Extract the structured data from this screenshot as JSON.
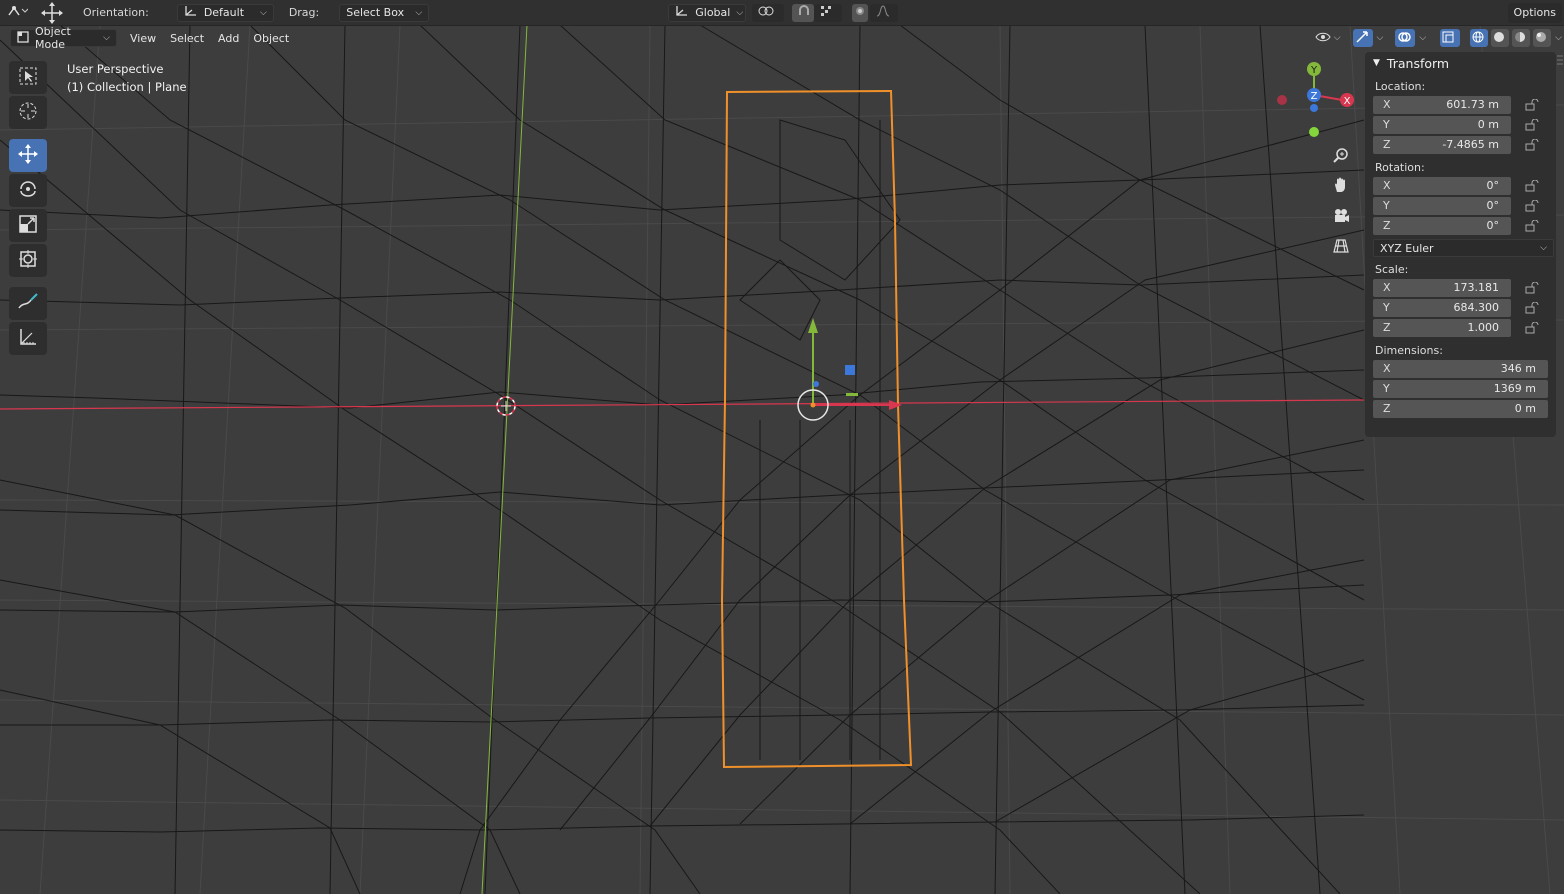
{
  "header": {
    "orientation_label": "Orientation:",
    "orientation_value": "Default",
    "drag_label": "Drag:",
    "drag_value": "Select Box",
    "transform_space": "Global",
    "options_label": "Options"
  },
  "menubar": {
    "mode": "Object Mode",
    "items": [
      "View",
      "Select",
      "Add",
      "Object"
    ]
  },
  "overlay": {
    "line1": "User Perspective",
    "line2": "(1) Collection | Plane"
  },
  "tools": [
    "select-box",
    "cursor",
    "move",
    "rotate",
    "scale",
    "transform",
    "annotate",
    "measure"
  ],
  "gizmo": {
    "x": "X",
    "y": "Y",
    "z": "Z"
  },
  "npanel": {
    "title": "Transform",
    "location": {
      "label": "Location:",
      "rows": [
        {
          "axis": "X",
          "value": "601.73 m"
        },
        {
          "axis": "Y",
          "value": "0 m"
        },
        {
          "axis": "Z",
          "value": "-7.4865 m"
        }
      ]
    },
    "rotation": {
      "label": "Rotation:",
      "rows": [
        {
          "axis": "X",
          "value": "0°"
        },
        {
          "axis": "Y",
          "value": "0°"
        },
        {
          "axis": "Z",
          "value": "0°"
        }
      ],
      "mode": "XYZ Euler"
    },
    "scale": {
      "label": "Scale:",
      "rows": [
        {
          "axis": "X",
          "value": "173.181"
        },
        {
          "axis": "Y",
          "value": "684.300"
        },
        {
          "axis": "Z",
          "value": "1.000"
        }
      ]
    },
    "dimensions": {
      "label": "Dimensions:",
      "rows": [
        {
          "axis": "X",
          "value": "346 m"
        },
        {
          "axis": "Y",
          "value": "1369 m"
        },
        {
          "axis": "Z",
          "value": "0 m"
        }
      ]
    }
  },
  "colors": {
    "viewport_bg": "#3d3d3d",
    "selection_outline": "#f0902a",
    "x_axis": "#d9374f",
    "y_axis": "#84b83b",
    "z_axis": "#3b78d9",
    "active_tool": "#4772b3"
  }
}
